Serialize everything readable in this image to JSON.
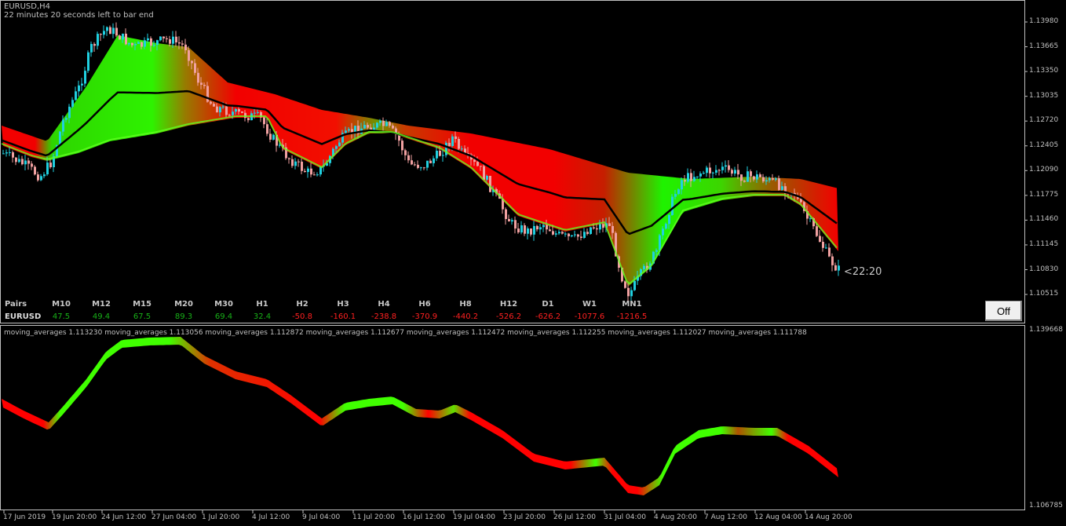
{
  "chart": {
    "symbol": "EURUSD,H4",
    "timer_text": "22 minutes 20 seconds left to bar end",
    "countdown_label": "<22:20",
    "off_button_label": "Off",
    "price_axis": [
      "1.13980",
      "1.13665",
      "1.13350",
      "1.13035",
      "1.12720",
      "1.12405",
      "1.12090",
      "1.11775",
      "1.11460",
      "1.11145",
      "1.10830",
      "1.10515"
    ],
    "sub_axis": [
      "1.139668",
      "1.106785"
    ],
    "subwindow_info": "moving_averages 1.113230 moving_averages 1.113056 moving_averages 1.112872 moving_averages 1.112677 moving_averages 1.112472 moving_averages 1.112255 moving_averages 1.112027 moving_averages 1.111788",
    "time_axis": [
      "17 Jun 2019",
      "19 Jun 20:00",
      "24 Jun 12:00",
      "27 Jun 04:00",
      "1 Jul 20:00",
      "4 Jul 12:00",
      "9 Jul 04:00",
      "11 Jul 20:00",
      "16 Jul 12:00",
      "19 Jul 04:00",
      "23 Jul 20:00",
      "26 Jul 12:00",
      "31 Jul 04:00",
      "4 Aug 20:00",
      "7 Aug 12:00",
      "12 Aug 04:00",
      "14 Aug 20:00"
    ],
    "colors": {
      "bull": "#00ff00",
      "bear": "#ff0000",
      "candle_up": "#20d0e0",
      "candle_down": "#f0a0a0",
      "grid": "#c0c0c0"
    }
  },
  "dashboard": {
    "pairs_header": "Pairs",
    "pair": "EURUSD",
    "columns": [
      {
        "tf": "M10",
        "value": "47.5",
        "sign": "pos"
      },
      {
        "tf": "M12",
        "value": "49.4",
        "sign": "pos"
      },
      {
        "tf": "M15",
        "value": "67.5",
        "sign": "pos"
      },
      {
        "tf": "M20",
        "value": "89.3",
        "sign": "pos"
      },
      {
        "tf": "M30",
        "value": "69.4",
        "sign": "pos"
      },
      {
        "tf": "H1",
        "value": "32.4",
        "sign": "pos"
      },
      {
        "tf": "H2",
        "value": "-50.8",
        "sign": "neg"
      },
      {
        "tf": "H3",
        "value": "-160.1",
        "sign": "neg"
      },
      {
        "tf": "H4",
        "value": "-238.8",
        "sign": "neg"
      },
      {
        "tf": "H6",
        "value": "-370.9",
        "sign": "neg"
      },
      {
        "tf": "H8",
        "value": "-440.2",
        "sign": "neg"
      },
      {
        "tf": "H12",
        "value": "-526.2",
        "sign": "neg"
      },
      {
        "tf": "D1",
        "value": "-626.2",
        "sign": "neg"
      },
      {
        "tf": "W1",
        "value": "-1077.6",
        "sign": "neg"
      },
      {
        "tf": "MN1",
        "value": "-1216.5",
        "sign": "neg"
      }
    ]
  }
}
